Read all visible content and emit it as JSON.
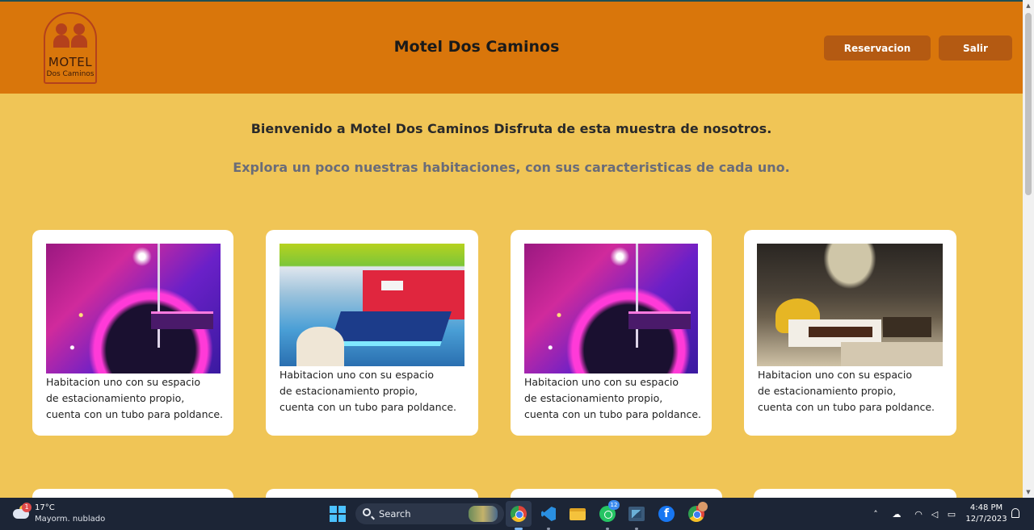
{
  "header": {
    "logo_text": "MOTEL",
    "logo_subtext": "Dos Caminos",
    "title": "Motel Dos Caminos",
    "buttons": {
      "reservation": "Reservacion",
      "logout": "Salir"
    }
  },
  "intro": {
    "welcome": "Bienvenido a Motel Dos Caminos Disfruta de esta muestra de nosotros.",
    "explore": "Explora un poco nuestras habitaciones, con sus caracteristicas de cada uno."
  },
  "rooms": [
    {
      "image": "disco-pole-room",
      "line1": "Habitacion uno con su espacio",
      "line2": "de estacionamiento propio,",
      "line3": "cuenta con un tubo para poldance."
    },
    {
      "image": "blue-neon-room",
      "line1": "Habitacion uno con su espacio",
      "line2": "de estacionamiento propio,",
      "line3": "cuenta con un tubo para poldance."
    },
    {
      "image": "disco-pole-room",
      "line1": "Habitacion uno con su espacio",
      "line2": "de estacionamiento propio,",
      "line3": "cuenta con un tubo para poldance."
    },
    {
      "image": "batman-themed-room",
      "line1": "Habitacion uno con su espacio",
      "line2": "de estacionamiento propio,",
      "line3": "cuenta con un tubo para poldance."
    }
  ],
  "taskbar": {
    "weather": {
      "temperature": "17°C",
      "condition": "Mayorm. nublado",
      "badge": "1"
    },
    "search_label": "Search",
    "whatsapp_badge": "12",
    "clock": {
      "time": "4:48 PM",
      "date": "12/7/2023"
    },
    "icons": [
      "start-icon",
      "search-icon",
      "chrome-icon",
      "vscode-icon",
      "file-explorer-icon",
      "whatsapp-icon",
      "sql-server-icon",
      "facebook-icon",
      "chrome-profile-icon"
    ],
    "tray_icons": [
      "chevron-up-icon",
      "onedrive-icon",
      "wifi-icon",
      "volume-icon",
      "battery-icon",
      "notification-bell-icon"
    ]
  },
  "colors": {
    "header_bg": "#d9760b",
    "page_bg": "#f0c556",
    "button_bg": "#b45a12",
    "card_bg": "#ffffff",
    "explore_text": "#6a6c78"
  }
}
